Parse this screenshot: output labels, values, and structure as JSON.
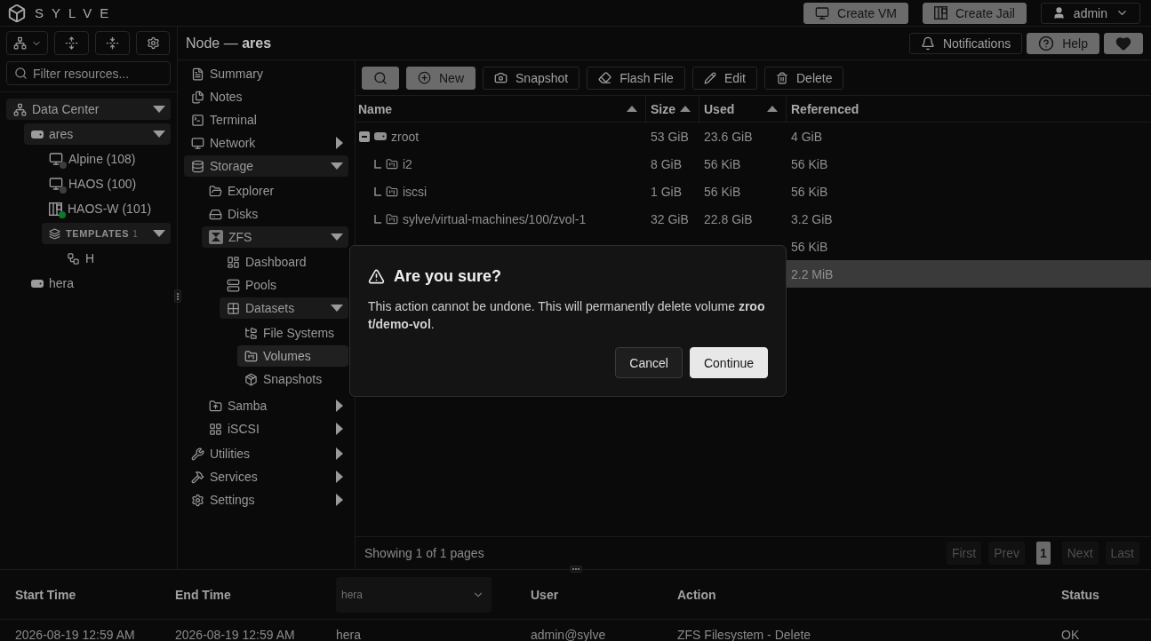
{
  "topbar": {
    "brand": "SYLVE",
    "actions": [
      {
        "label": "Create VM",
        "kind": "vm"
      },
      {
        "label": "Create Jail",
        "kind": "jail"
      }
    ],
    "user": "admin"
  },
  "sidebar": {
    "filter": {
      "placeholder": "Filter resources..."
    },
    "tree": [
      {
        "label": "Data Center",
        "kind": "datacenter",
        "expanded": true,
        "children": [
          {
            "label": "ares",
            "kind": "node",
            "expanded": true,
            "children": [
              {
                "label": "Alpine (108)",
                "kind": "vm",
                "color": "#3d3d3d"
              },
              {
                "label": "HAOS (100)",
                "kind": "vm",
                "color": "#3d3d3d"
              },
              {
                "label": "HAOS-W (101)",
                "kind": "jail",
                "color": "#0b7a2b"
              },
              {
                "label": "TEMPLATES",
                "kind": "group",
                "count": "1",
                "expanded": true,
                "children": [
                  {
                    "label": "H",
                    "kind": "template"
                  }
                ]
              }
            ]
          },
          {
            "label": "hera",
            "kind": "node"
          }
        ]
      }
    ]
  },
  "header": {
    "title": "Node — **ares**",
    "actions": [
      {
        "label": "Notifications",
        "kind": "bell",
        "primary": false
      },
      {
        "label": "Help",
        "kind": "help",
        "primary": true
      },
      {
        "kind": "heart",
        "primary": true
      }
    ]
  },
  "nav": [
    {
      "label": "Summary",
      "kind": "summary",
      "selected": false
    },
    {
      "label": "Notes",
      "kind": "notes",
      "selected": false
    },
    {
      "label": "Terminal",
      "kind": "terminal",
      "selected": false
    },
    {
      "label": "Network",
      "kind": "network",
      "selected": false,
      "expanded": false
    },
    {
      "label": "Storage",
      "kind": "storage",
      "selected": false,
      "expanded": true,
      "children": [
        {
          "label": "Explorer",
          "kind": "explorer",
          "selected": false
        },
        {
          "label": "Disks",
          "kind": "disks",
          "selected": false
        },
        {
          "label": "ZFS",
          "kind": "zfs",
          "selected": false,
          "expanded": true,
          "children": [
            {
              "label": "Dashboard",
              "kind": "dashboard",
              "selected": false
            },
            {
              "label": "Pools",
              "kind": "pools",
              "selected": false
            },
            {
              "label": "Datasets",
              "kind": "datasets",
              "selected": false,
              "expanded": true,
              "children": [
                {
                  "label": "File Systems",
                  "kind": "filesystems",
                  "selected": false
                },
                {
                  "label": "Volumes",
                  "kind": "volumes",
                  "selected": true
                },
                {
                  "label": "Snapshots",
                  "kind": "snapshots",
                  "selected": false
                }
              ]
            }
          ]
        },
        {
          "label": "Samba",
          "kind": "samba",
          "selected": false,
          "expanded": false
        },
        {
          "label": "iSCSI",
          "kind": "iscsi",
          "selected": false,
          "expanded": false
        }
      ]
    },
    {
      "label": "Utilities",
      "kind": "utilities",
      "selected": false,
      "expanded": false
    },
    {
      "label": "Services",
      "kind": "services",
      "selected": false,
      "expanded": false
    },
    {
      "label": "Settings",
      "kind": "settings",
      "selected": false,
      "expanded": false
    }
  ],
  "toolbar": [
    {
      "kind": "search",
      "primary": true
    },
    {
      "label": "New",
      "kind": "new",
      "primary": true
    },
    {
      "label": "Snapshot",
      "kind": "snapshot",
      "primary": false
    },
    {
      "label": "Flash File",
      "kind": "flash",
      "primary": false
    },
    {
      "label": "Edit",
      "kind": "edit",
      "primary": false
    },
    {
      "label": "Delete",
      "kind": "delete",
      "primary": false
    }
  ],
  "table": {
    "columns": [
      {
        "label": "Name",
        "sortable": true
      },
      {
        "label": "Size",
        "sortable": true
      },
      {
        "label": "Used",
        "sortable": true
      },
      {
        "label": "Referenced",
        "sortable": false
      }
    ],
    "rows": [
      {
        "name": "zroot",
        "kind": "pool",
        "expanded": true,
        "selected": false,
        "size": "53 GiB",
        "used": "23.6 GiB",
        "referenced": "4 GiB",
        "children": [
          {
            "name": "i2",
            "kind": "volume",
            "selected": false,
            "size": "8 GiB",
            "used": "56 KiB",
            "referenced": "56 KiB"
          },
          {
            "name": "iscsi",
            "kind": "volume",
            "selected": false,
            "size": "1 GiB",
            "used": "56 KiB",
            "referenced": "56 KiB"
          },
          {
            "name": "sylve/virtual-machines/100/zvol-1",
            "kind": "volume",
            "selected": false,
            "size": "32 GiB",
            "used": "22.8 GiB",
            "referenced": "3.2 GiB"
          },
          {
            "selected": false,
            "referenced": "56 KiB"
          },
          {
            "selected": true,
            "referenced": "2.2 MiB"
          }
        ]
      }
    ],
    "summary": "Showing 1 of 1 pages",
    "pagination": [
      {
        "label": "First",
        "disabled": true,
        "selected": false
      },
      {
        "label": "Prev",
        "disabled": true,
        "selected": false
      },
      {
        "label": "1",
        "disabled": false,
        "selected": true
      },
      {
        "label": "Next",
        "disabled": true,
        "selected": false
      },
      {
        "label": "Last",
        "disabled": true,
        "selected": false
      }
    ]
  },
  "log": {
    "columns": [
      {
        "kind": "text",
        "label": "Start Time"
      },
      {
        "kind": "text",
        "label": "End Time"
      },
      {
        "kind": "select",
        "value": "hera"
      },
      {
        "kind": "text",
        "label": "User"
      },
      {
        "kind": "text",
        "label": "Action"
      },
      {
        "kind": "text",
        "label": "Status"
      }
    ],
    "rows": [
      [
        "2026-08-19 12:59 AM",
        "2026-08-19 12:59 AM",
        "hera",
        "admin@sylve",
        "ZFS Filesystem - Delete",
        "OK"
      ]
    ]
  },
  "dialog": {
    "title": "Are you sure?",
    "message": "This action cannot be undone. This will permanently delete volume **zroot/demo-vol**.",
    "buttons": [
      {
        "label": "Cancel",
        "kind": "secondary"
      },
      {
        "label": "Continue",
        "kind": "primary"
      }
    ]
  }
}
